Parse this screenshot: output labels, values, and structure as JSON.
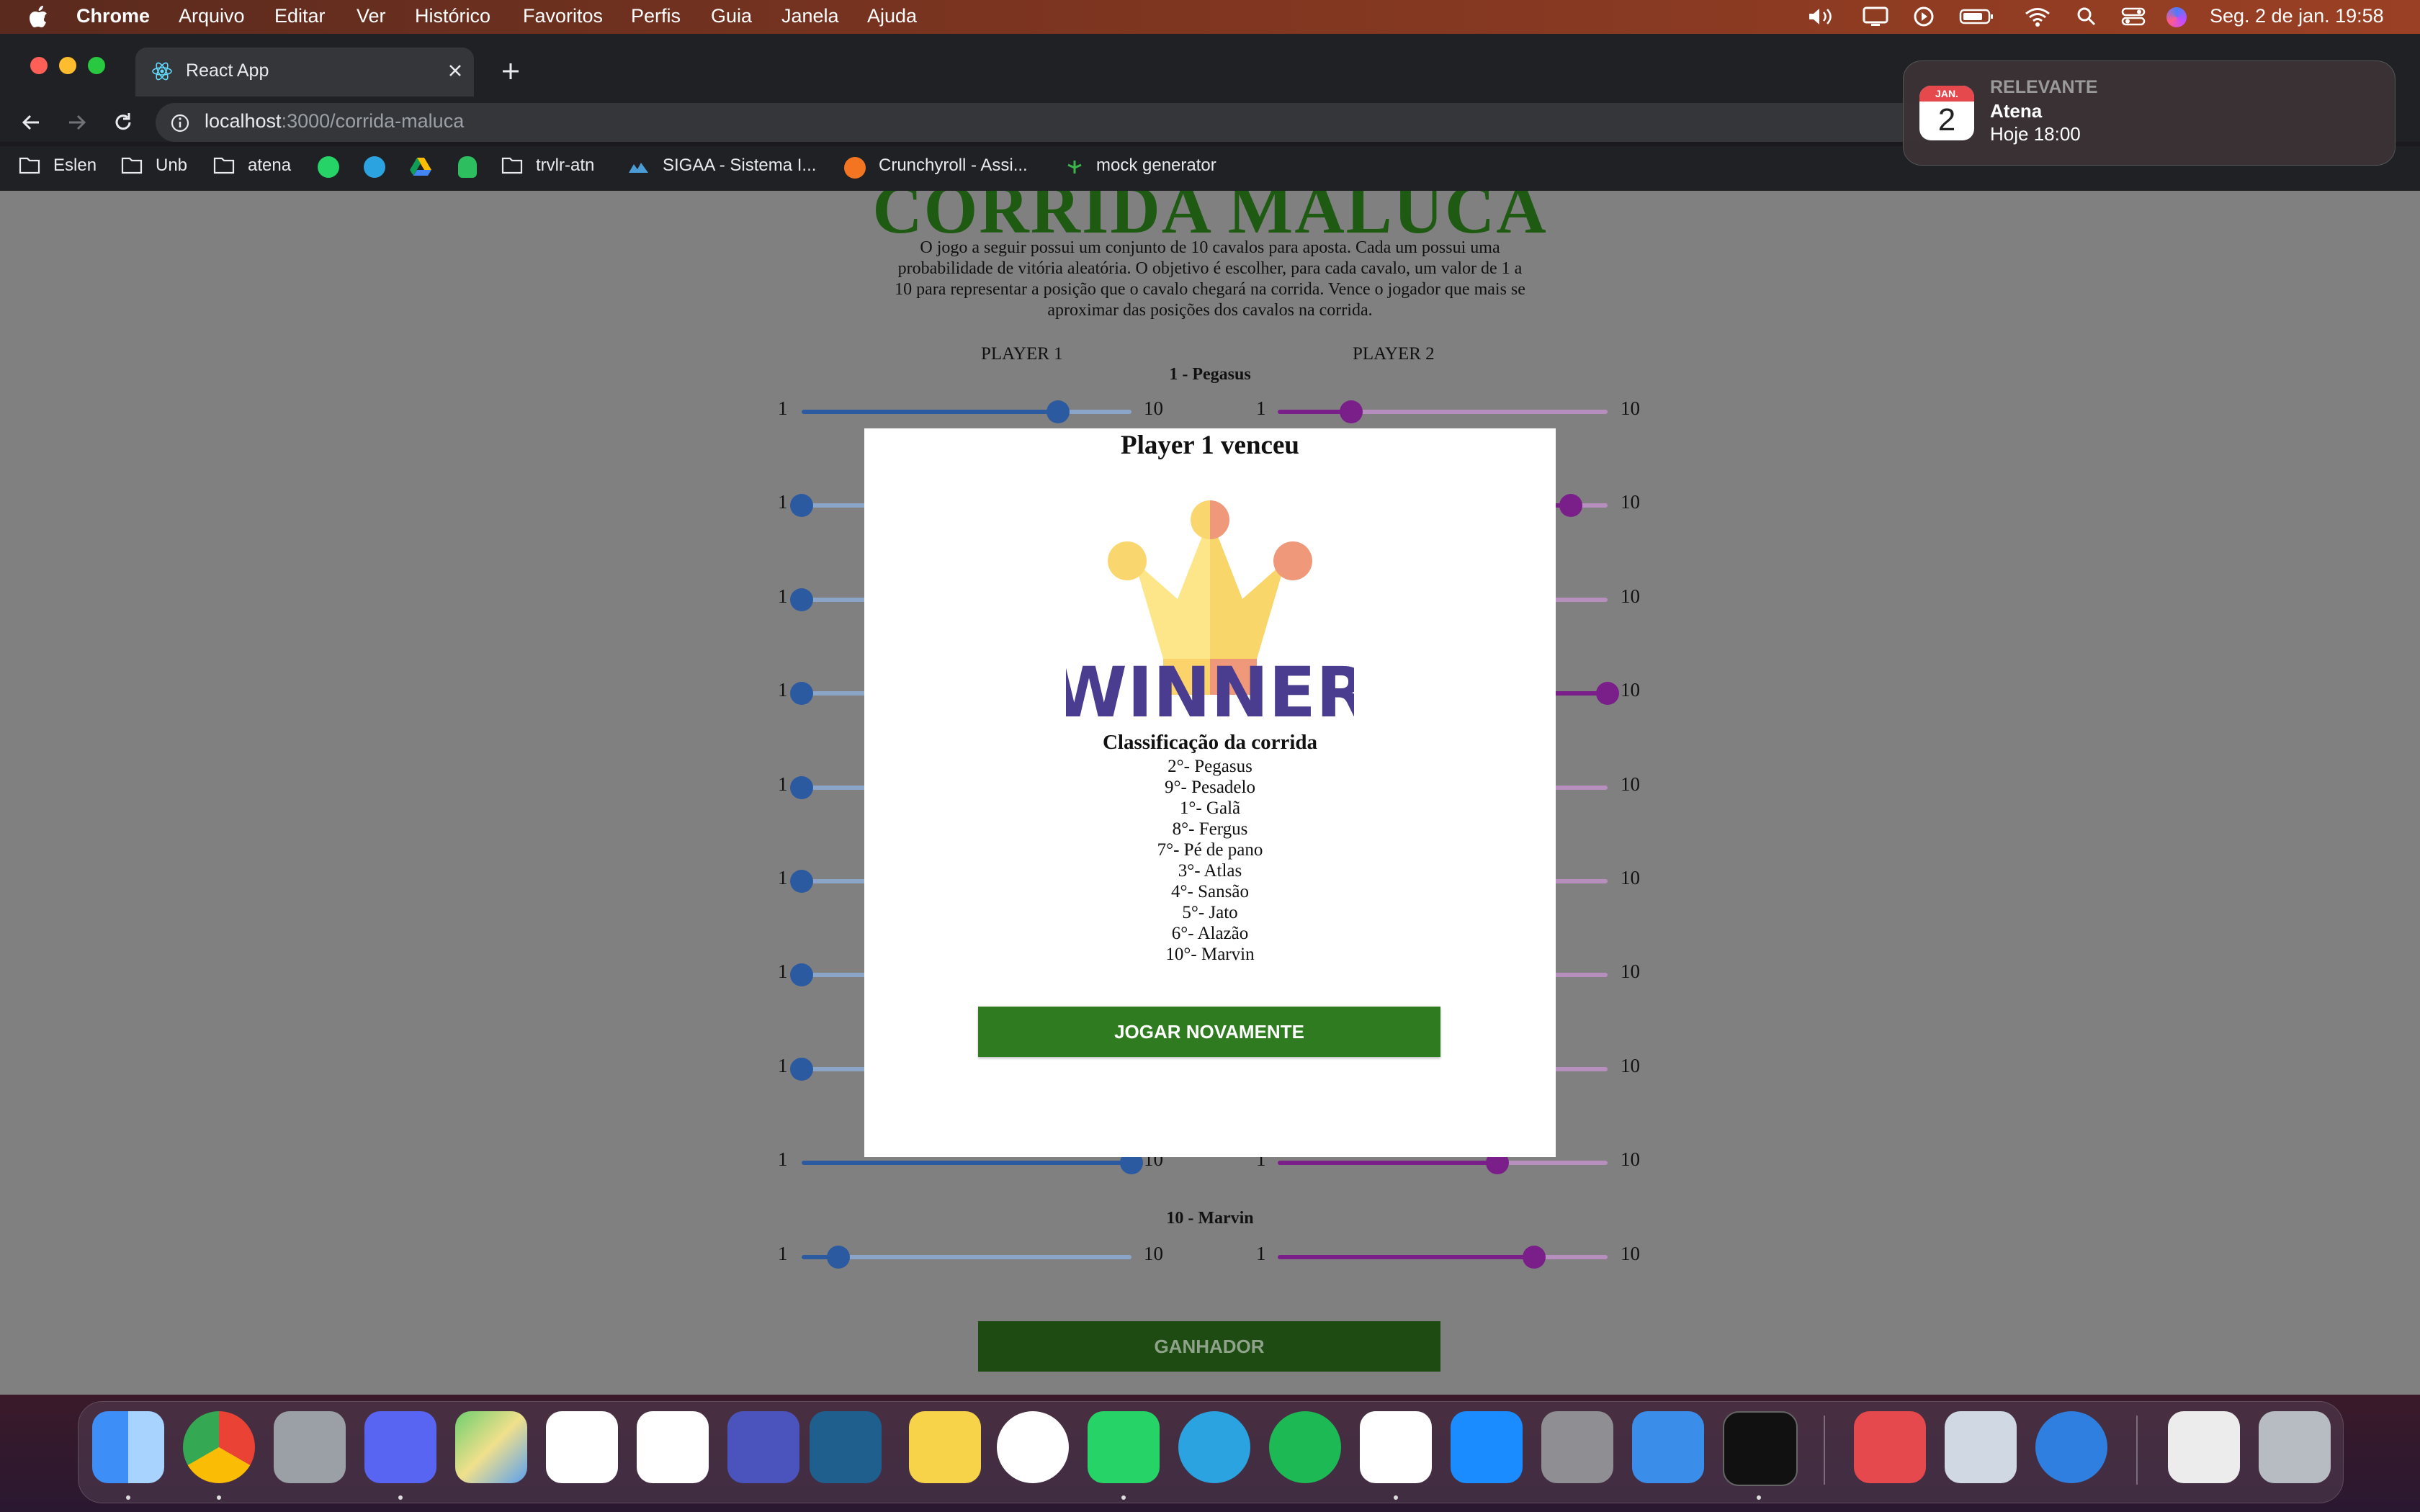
{
  "menubar": {
    "items": [
      "Chrome",
      "Arquivo",
      "Editar",
      "Ver",
      "Histórico",
      "Favoritos",
      "Perfis",
      "Guia",
      "Janela",
      "Ajuda"
    ],
    "datetime": "Seg. 2 de jan.  19:58"
  },
  "browser": {
    "tab_title": "React App",
    "url_host": "localhost",
    "url_path": ":3000/corrida-maluca",
    "bookmarks": [
      "Eslen",
      "Unb",
      "atena",
      "trvlr-atn",
      "SIGAA - Sistema I...",
      "Crunchyroll - Assi...",
      "mock generator"
    ]
  },
  "notification": {
    "cal_month": "JAN.",
    "cal_day": "2",
    "category": "RELEVANTE",
    "title": "Atena",
    "time": "Hoje 18:00"
  },
  "page": {
    "title": "CORRIDA MALUCA",
    "description": "O jogo a seguir possui um conjunto de 10 cavalos para aposta. Cada um possui uma probabilidade de vitória aleatória. O objetivo é escolher, para cada cavalo, um valor de 1 a 10 para representar a posição que o cavalo chegará na corrida. Vence o jogador que mais se aproximar das posições dos cavalos na corrida.",
    "player1_label": "PLAYER 1",
    "player2_label": "PLAYER 2",
    "first_horse": "1 - Pegasus",
    "last_horse": "10 - Marvin",
    "slider_min": "1",
    "slider_max": "10",
    "winner_button": "GANHADOR",
    "player1_values": [
      8,
      1,
      1,
      1,
      1,
      1,
      1,
      1,
      10,
      2
    ],
    "player2_values": [
      3,
      9,
      1,
      10,
      1,
      1,
      1,
      1,
      7,
      8
    ]
  },
  "modal": {
    "title": "Player 1 venceu",
    "winner_text": "WINNER",
    "ranking_title": "Classificação da corrida",
    "ranking": [
      "2°- Pegasus",
      "9°- Pesadelo",
      "1°- Galã",
      "8°- Fergus",
      "7°- Pé de pano",
      "3°- Atlas",
      "4°- Sansão",
      "5°- Jato",
      "6°- Alazão",
      "10°- Marvin"
    ],
    "play_again": "JOGAR NOVAMENTE"
  },
  "colors": {
    "player1": "#2c5aa0",
    "player2": "#7a1f8a",
    "title_green": "#1f5a12",
    "button_green": "#2f7b20"
  }
}
